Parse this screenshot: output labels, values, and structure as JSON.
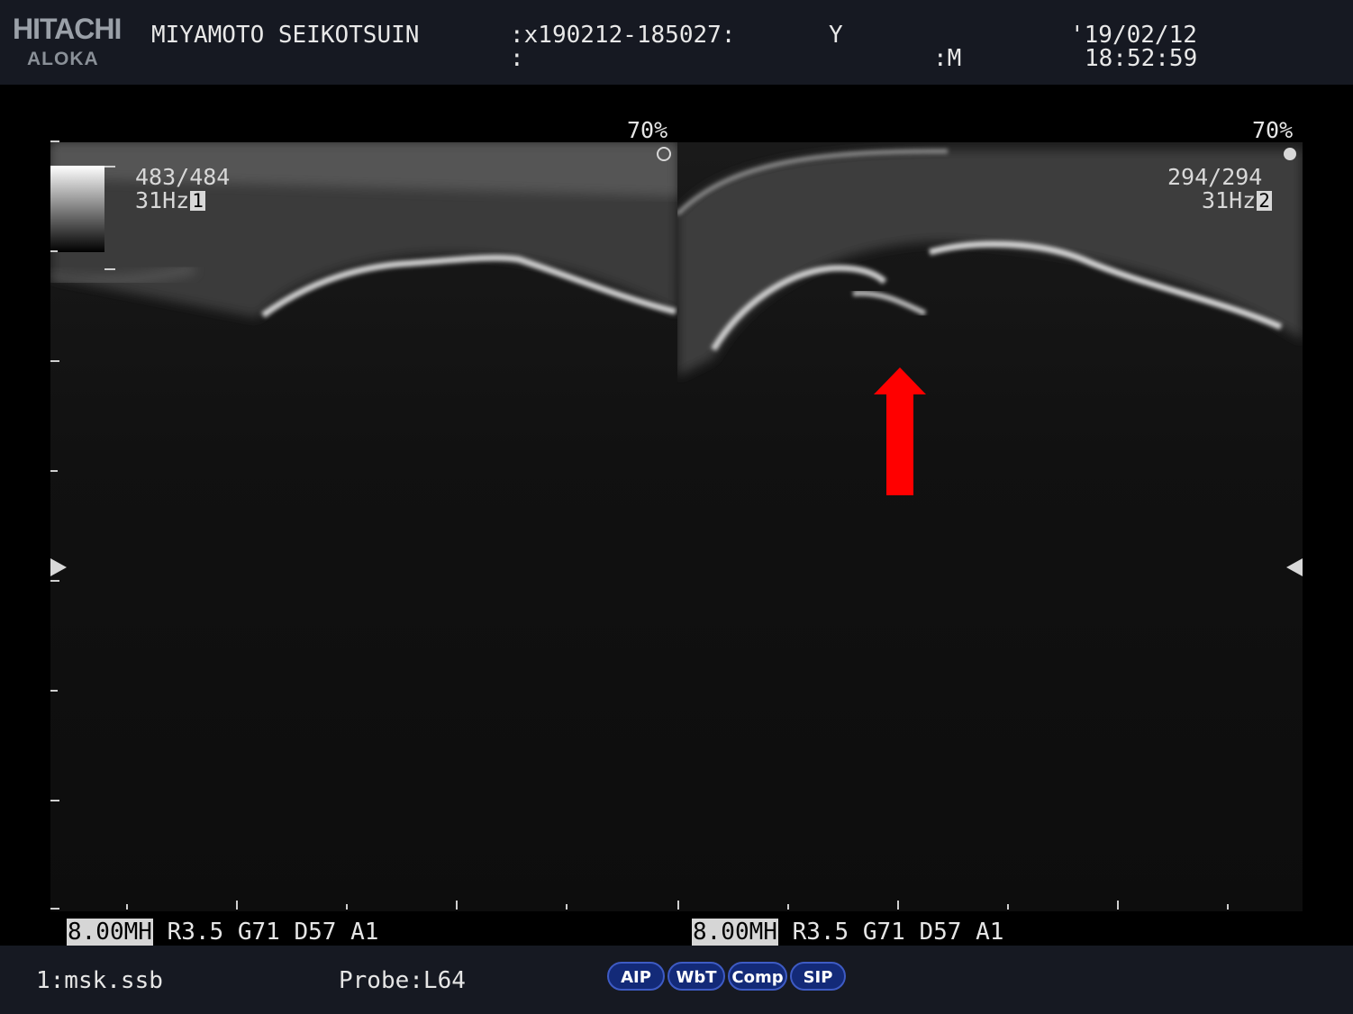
{
  "header": {
    "logo_top": "HITACHI",
    "logo_bottom": "ALOKA",
    "institution": "MIYAMOTO SEIKOTSUIN",
    "patient_id": ":x190212-185027:",
    "field_y": "Y",
    "colon2": ":",
    "field_m": ":M",
    "date": "'19/02/12",
    "time": "18:52:59"
  },
  "left_pane": {
    "gain_percent": "70%",
    "frames": "483/484",
    "frame_rate": "31Hz",
    "pane_number": "1",
    "params": {
      "freq": "8.00MH",
      "rest": " R3.5 G71 D57 A1"
    }
  },
  "right_pane": {
    "gain_percent": "70%",
    "frames": "294/294",
    "frame_rate": "31Hz",
    "pane_number": "2",
    "params": {
      "freq": "8.00MH",
      "rest": " R3.5 G71 D57 A1"
    }
  },
  "footer": {
    "preset": "1:msk.ssb",
    "probe": "Probe:L64",
    "buttons": [
      "AIP",
      "WbT",
      "Comp",
      "SIP"
    ]
  },
  "colors": {
    "arrow": "#ff0000",
    "panel_bg": "#161922",
    "pill_bg": "#132a78"
  }
}
